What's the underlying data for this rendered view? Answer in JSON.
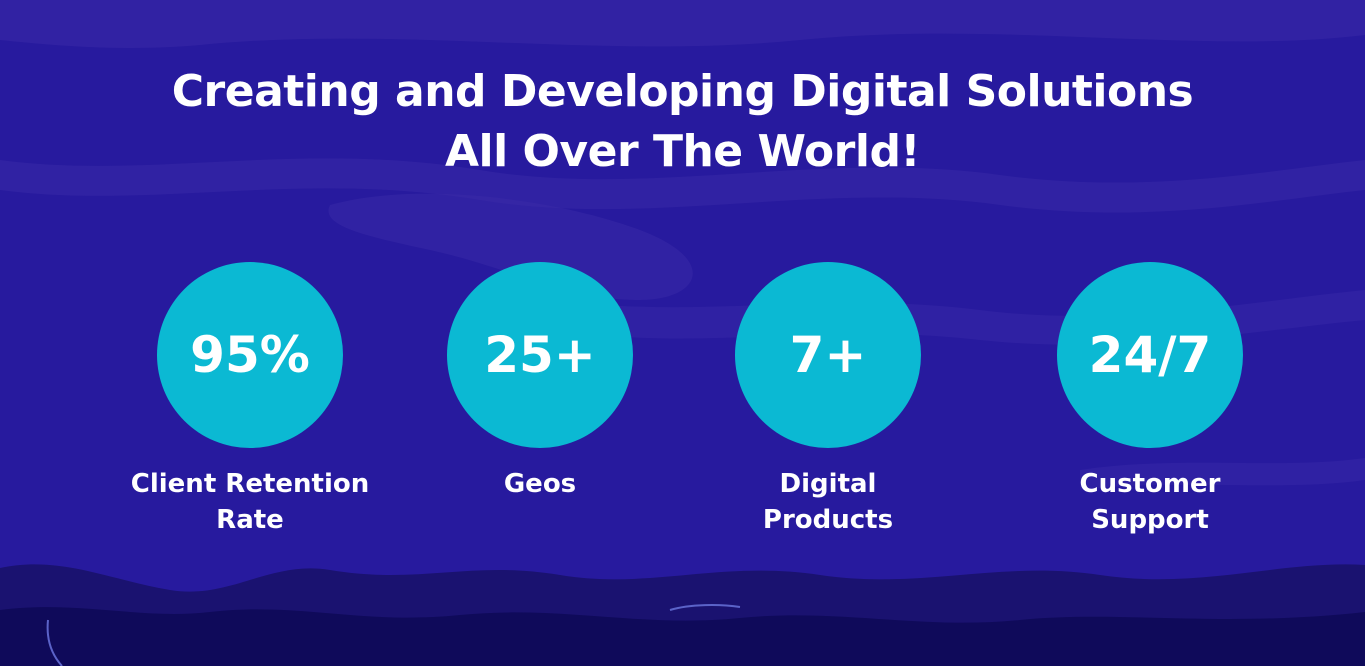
{
  "colors": {
    "background": "#271a9e",
    "circle": "#0bb9d3",
    "text": "#ffffff",
    "hills": "#0f0a5a"
  },
  "headline": {
    "line1": "Creating and Developing Digital Solutions",
    "line2": "All Over The World!"
  },
  "stats": [
    {
      "value": "95%",
      "label_line1": "Client Retention",
      "label_line2": "Rate"
    },
    {
      "value": "25+",
      "label_line1": "Geos",
      "label_line2": ""
    },
    {
      "value": "7+",
      "label_line1": "Digital",
      "label_line2": "Products"
    },
    {
      "value": "24/7",
      "label_line1": "Customer",
      "label_line2": "Support"
    }
  ]
}
